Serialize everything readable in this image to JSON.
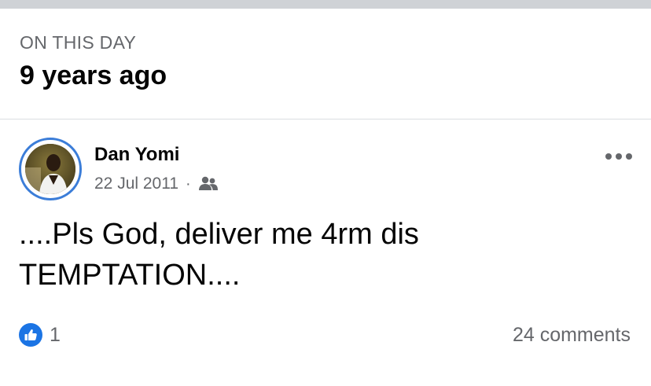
{
  "memory": {
    "eyebrow": "ON THIS DAY",
    "headline": "9 years ago"
  },
  "post": {
    "author": "Dan Yomi",
    "date": "22 Jul 2011",
    "separator": "·",
    "audience_icon": "friends-icon",
    "menu_icon": "more-options-icon",
    "text": "....Pls God, deliver me 4rm dis\nTEMPTATION....",
    "reaction_icon": "like-icon",
    "reaction_count": "1",
    "comments_label": "24 comments"
  },
  "colors": {
    "accent": "#1b74e4",
    "avatar_ring": "#3b7dd8",
    "secondary_text": "#65676b",
    "primary_text": "#050505"
  }
}
